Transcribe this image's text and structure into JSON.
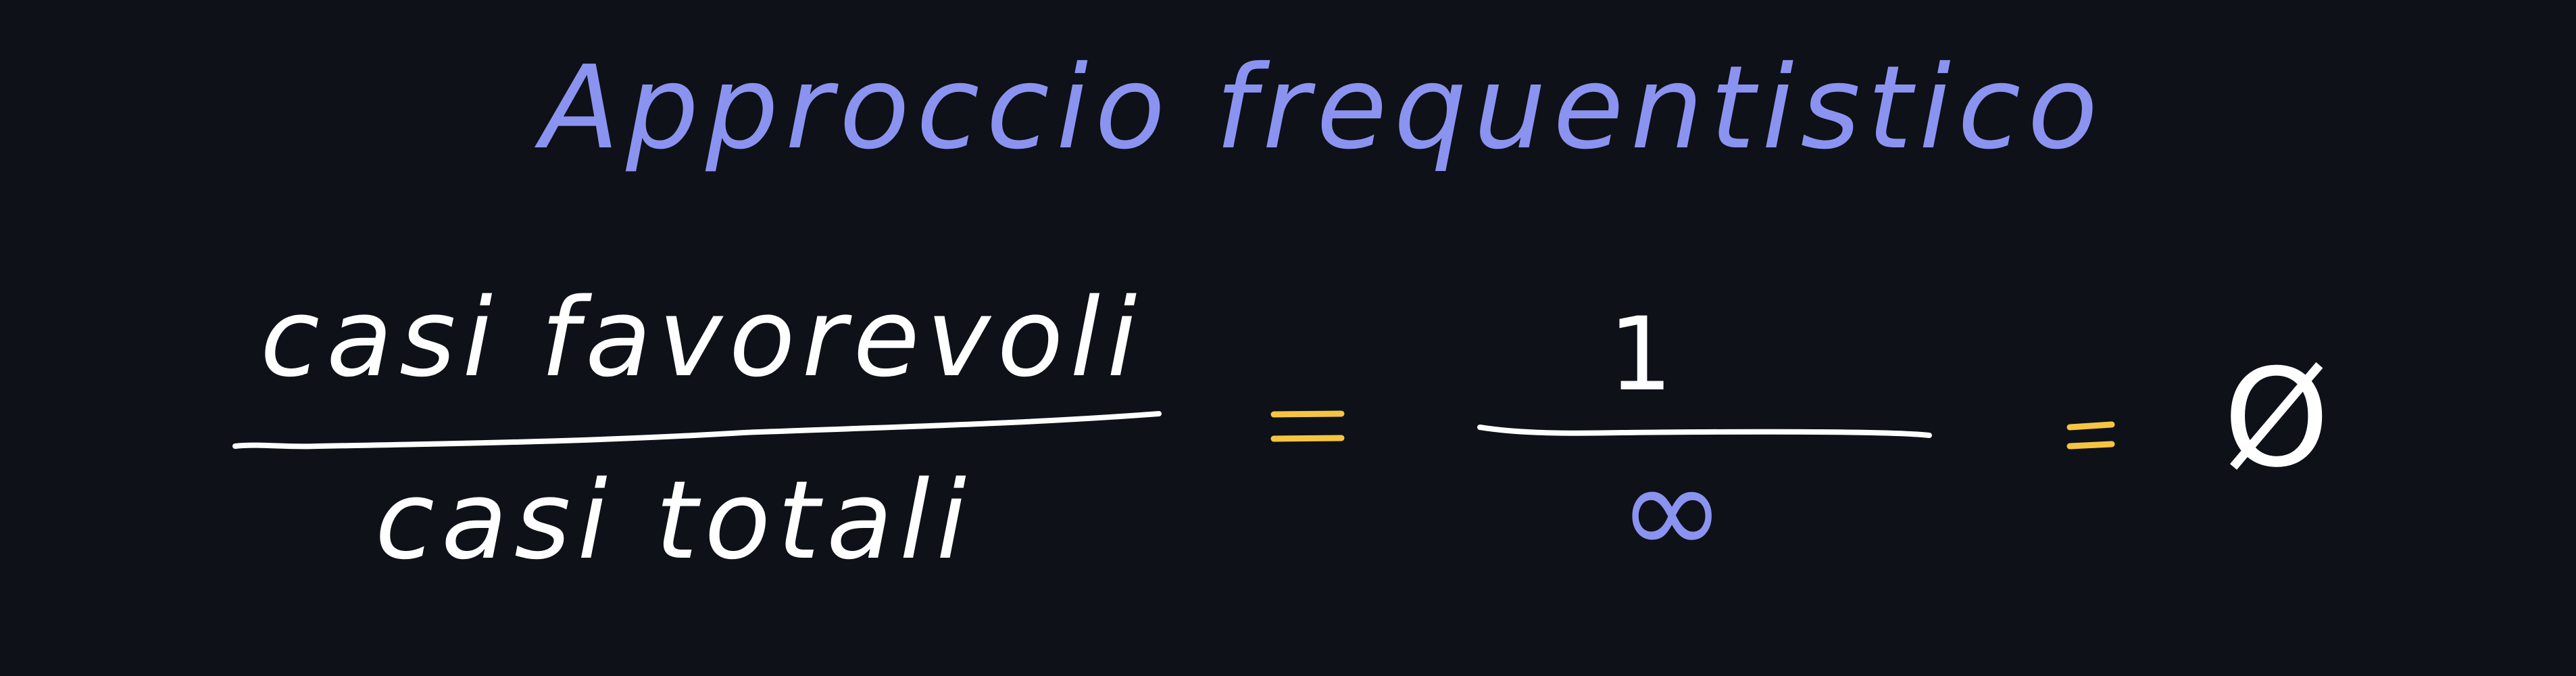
{
  "colors": {
    "background": "#0e1117",
    "accent_blue": "#8b93f0",
    "text_white": "#ffffff",
    "equals_yellow": "#f5c542"
  },
  "title": "Approccio frequentistico",
  "formula": {
    "numerator": "casi favorevoli",
    "denominator": "casi totali",
    "rhs_numerator": "1",
    "rhs_denominator": "∞",
    "result": "Ø"
  }
}
